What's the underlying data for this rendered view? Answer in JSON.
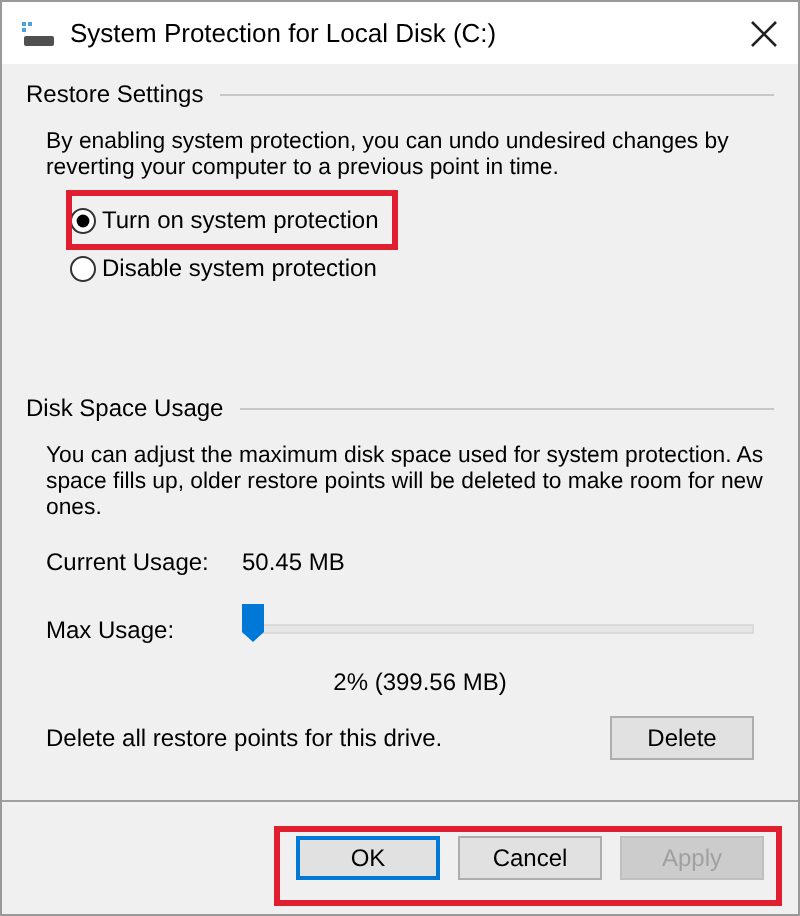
{
  "window": {
    "title": "System Protection for Local Disk (C:)"
  },
  "restore_settings": {
    "heading": "Restore Settings",
    "description": "By enabling system protection, you can undo undesired changes by reverting your computer to a previous point in time.",
    "options": [
      {
        "label": "Turn on system protection",
        "selected": true
      },
      {
        "label": "Disable system protection",
        "selected": false
      }
    ]
  },
  "disk_space_usage": {
    "heading": "Disk Space Usage",
    "description": "You can adjust the maximum disk space used for system protection. As space fills up, older restore points will be deleted to make room for new ones.",
    "current_usage_label": "Current Usage:",
    "current_usage": "50.45 MB",
    "max_usage_label": "Max Usage:",
    "max_usage": {
      "level": 0.02
    },
    "max_usage_reading": "2% (399.56 MB)",
    "delete_text": "Delete all restore points for this drive.",
    "delete_button": "Delete"
  },
  "buttons": [
    {
      "label": "OK",
      "default": true,
      "disabled": false
    },
    {
      "label": "Cancel",
      "default": false,
      "disabled": false
    },
    {
      "label": "Apply",
      "default": false,
      "disabled": true
    }
  ]
}
